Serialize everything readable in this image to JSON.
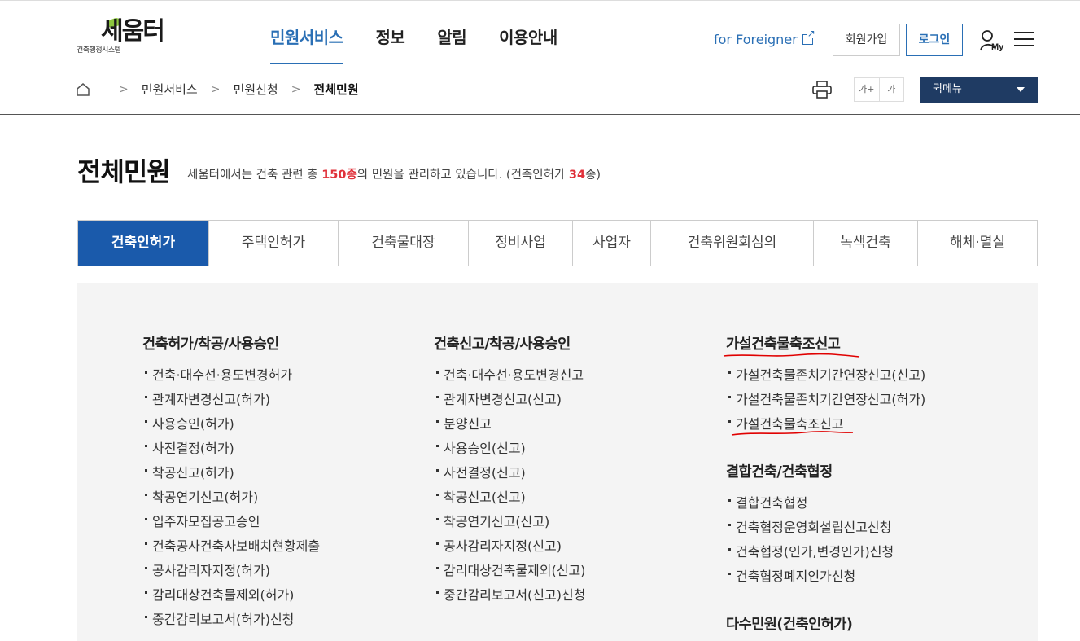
{
  "logo": {
    "main": "세움터",
    "sub": "건축행정시스템"
  },
  "gnb": [
    {
      "label": "민원서비스",
      "active": true
    },
    {
      "label": "정보",
      "active": false
    },
    {
      "label": "알림",
      "active": false
    },
    {
      "label": "이용안내",
      "active": false
    }
  ],
  "header": {
    "foreigner": "for Foreigner",
    "join": "회원가입",
    "login": "로그인",
    "my": "My"
  },
  "breadcrumb": [
    "민원서비스",
    "민원신청",
    "전체민원"
  ],
  "fontsize": {
    "larger": "가+",
    "normal": "가"
  },
  "quickmenu": {
    "label": "퀵메뉴"
  },
  "page": {
    "title": "전체민원",
    "desc_pre": "세움터에서는 건축 관련 총 ",
    "desc_total": "150종",
    "desc_mid": "의 민원을 관리하고 있습니다. (건축인허가 ",
    "desc_count": "34",
    "desc_post": "종)"
  },
  "tabs": [
    "건축인허가",
    "주택인허가",
    "건축물대장",
    "정비사업",
    "사업자",
    "건축위원회심의",
    "녹색건축",
    "해체·멸실"
  ],
  "columns": {
    "col1": {
      "title": "건축허가/착공/사용승인",
      "items": [
        "건축·대수선·용도변경허가",
        "관계자변경신고(허가)",
        "사용승인(허가)",
        "사전결정(허가)",
        "착공신고(허가)",
        "착공연기신고(허가)",
        "입주자모집공고승인",
        "건축공사건축사보배치현황제출",
        "공사감리자지정(허가)",
        "감리대상건축물제외(허가)",
        "중간감리보고서(허가)신청"
      ]
    },
    "col2": {
      "title": "건축신고/착공/사용승인",
      "items": [
        "건축·대수선·용도변경신고",
        "관계자변경신고(신고)",
        "분양신고",
        "사용승인(신고)",
        "사전결정(신고)",
        "착공신고(신고)",
        "착공연기신고(신고)",
        "공사감리자지정(신고)",
        "감리대상건축물제외(신고)",
        "중간감리보고서(신고)신청"
      ]
    },
    "col3a": {
      "title": "가설건축물축조신고",
      "items": [
        "가설건축물존치기간연장신고(신고)",
        "가설건축물존치기간연장신고(허가)",
        "가설건축물축조신고"
      ]
    },
    "col3b": {
      "title": "결합건축/건축협정",
      "items": [
        "결합건축협정",
        "건축협정운영회설립신고신청",
        "건축협정(인가,변경인가)신청",
        "건축협정폐지인가신청"
      ]
    },
    "col3c": {
      "title": "다수민원(건축인허가)"
    }
  },
  "colors": {
    "accent": "#2a6fb5",
    "tab_active": "#1a5aab",
    "highlight": "#e0313a",
    "quickmenu": "#1f3b63",
    "annotation": "#e00000"
  }
}
